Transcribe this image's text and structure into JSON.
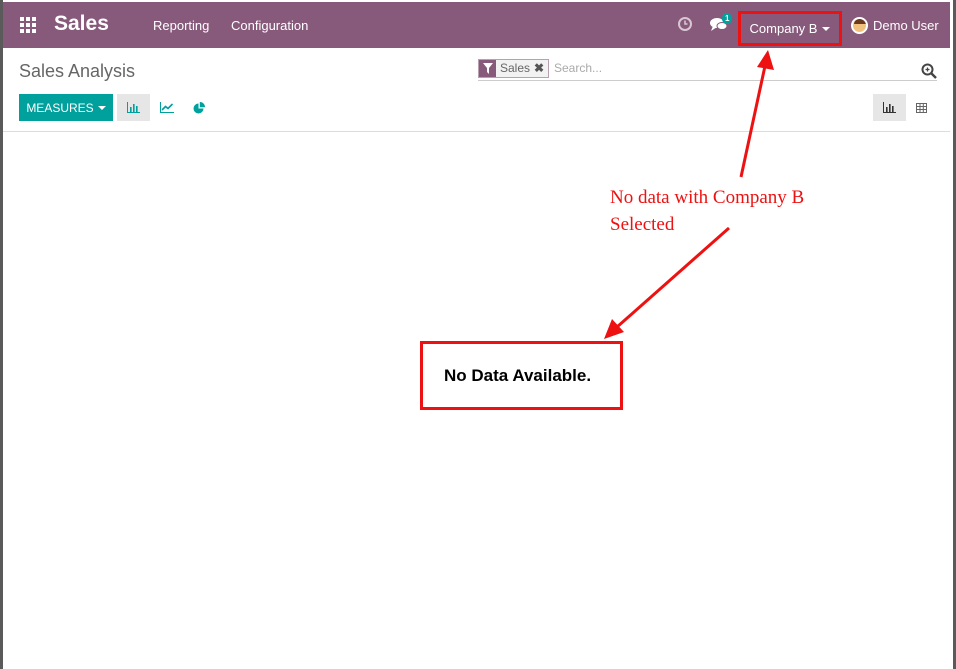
{
  "navbar": {
    "app_name": "Sales",
    "menu": [
      "Reporting",
      "Configuration"
    ],
    "notification_count": "1",
    "company": "Company B",
    "user": "Demo User",
    "color": "#875a7b"
  },
  "control_panel": {
    "title": "Sales Analysis",
    "facet": "Sales",
    "search_placeholder": "Search...",
    "measures_label": "MEASURES",
    "accent": "#00a09d"
  },
  "main": {
    "empty_message": "No Data Available."
  },
  "annotations": {
    "note_line1": "No data with Company B",
    "note_line2": "Selected",
    "highlight_color": "#ee1111"
  },
  "icons": [
    "apps-icon",
    "clock-icon",
    "chat-icon",
    "caret-down-icon",
    "filter-icon",
    "remove-icon",
    "search-icon",
    "bar-chart-icon",
    "line-chart-icon",
    "pie-chart-icon",
    "table-icon"
  ]
}
